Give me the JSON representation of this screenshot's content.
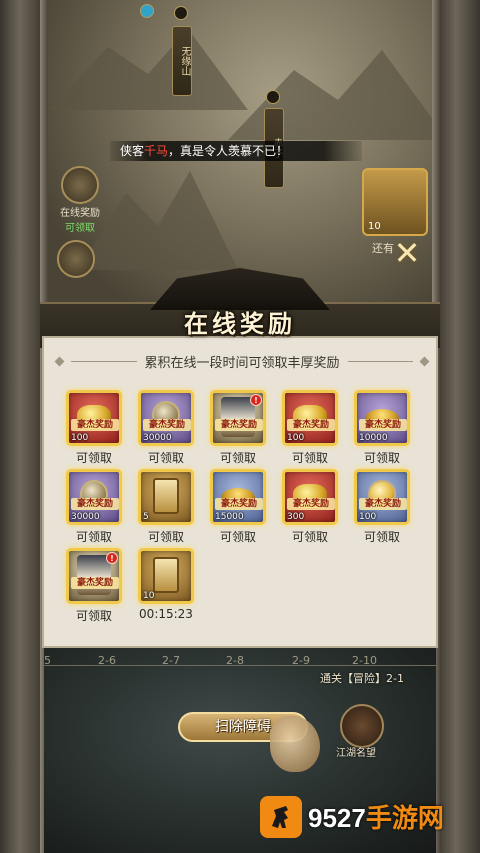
{
  "map": {
    "tower_left": "无缘山",
    "tower_right": "赤子",
    "chat": {
      "prefix": "侠客",
      "highlight": "千马",
      "message": "，真是令人羡慕不已！"
    },
    "side_left_label": "在线奖励",
    "side_left_sublabel": "可领取",
    "card_right_count": "10",
    "side_right_label": "还有"
  },
  "panel": {
    "title": "在线奖励",
    "subtitle": "累积在线一段时间可领取丰厚奖励",
    "stamp_text": "豪杰奖励",
    "rewards": [
      {
        "qty": "100",
        "status": "可领取",
        "kind": "gold-ingot",
        "bg": "red"
      },
      {
        "qty": "30000",
        "status": "可领取",
        "kind": "silver-coin",
        "bg": "purple"
      },
      {
        "qty": "",
        "status": "可领取",
        "kind": "hero-portrait",
        "bg": "hero"
      },
      {
        "qty": "100",
        "status": "可领取",
        "kind": "gold-ingot",
        "bg": "red"
      },
      {
        "qty": "10000",
        "status": "可领取",
        "kind": "treasure-bowl",
        "bg": "purple"
      },
      {
        "qty": "30000",
        "status": "可领取",
        "kind": "silver-coin",
        "bg": "purple"
      },
      {
        "qty": "5",
        "status": "可领取",
        "kind": "sweep-ticket",
        "bg": "gold"
      },
      {
        "qty": "15000",
        "status": "可领取",
        "kind": "treasure-bowl",
        "bg": "blue"
      },
      {
        "qty": "300",
        "status": "可领取",
        "kind": "gold-ingot",
        "bg": "red"
      },
      {
        "qty": "100",
        "status": "可领取",
        "kind": "gold-pearl",
        "bg": "blue"
      },
      {
        "qty": "",
        "status": "可领取",
        "kind": "hero-portrait",
        "bg": "hero"
      },
      {
        "qty": "10",
        "status": "00:15:23",
        "kind": "sweep-ticket",
        "bg": "gold"
      }
    ]
  },
  "stages": [
    "5",
    "2-6",
    "2-7",
    "2-8",
    "2-9",
    "2-10"
  ],
  "progress_text": "通关【冒险】2-1",
  "sweep_button": "扫除障碍",
  "famous_label": "江湖名望",
  "watermark": {
    "number": "9527",
    "brand": "手游网"
  },
  "colors": {
    "panel_bg": "#e8e3d6",
    "reward_border": "#f1c94a",
    "badge_red": "#d8261c",
    "watermark_orange": "#f08a12"
  }
}
